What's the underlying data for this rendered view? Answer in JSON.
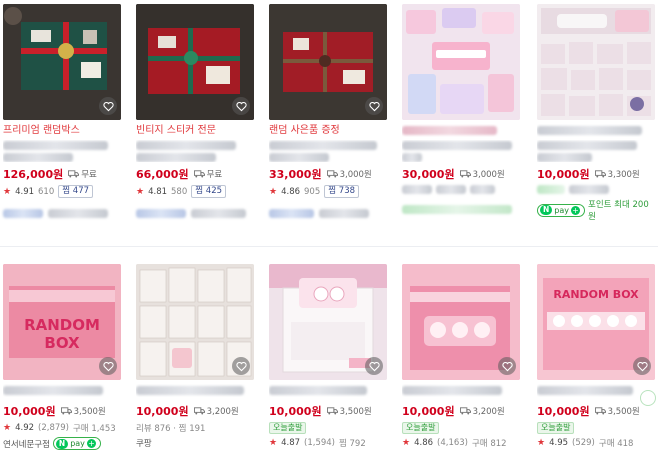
{
  "colors": {
    "price": "#d0001c",
    "title_red": "#e0373b",
    "npay": "#03c75a"
  },
  "row1": [
    {
      "title": "프리미엄 랜덤박스",
      "title_style": "red",
      "price": "126,000원",
      "ship": "무료",
      "rating": "4.91",
      "reviews": "610",
      "zzim_label": "찜",
      "zzim": "477",
      "extra": ""
    },
    {
      "title": "빈티지 스티커 전문",
      "title_style": "red",
      "price": "66,000원",
      "ship": "무료",
      "rating": "4.81",
      "reviews": "580",
      "zzim_label": "찜",
      "zzim": "425",
      "extra": ""
    },
    {
      "title": "랜덤 사은품 증정",
      "title_style": "red",
      "price": "33,000원",
      "ship": "3,000원",
      "rating": "4.86",
      "reviews": "905",
      "zzim_label": "찜",
      "zzim": "738",
      "extra": ""
    },
    {
      "title": "",
      "title_style": "red",
      "price": "30,000원",
      "ship": "3,000원",
      "rating": "",
      "reviews": "",
      "zzim_label": "",
      "zzim": "",
      "extra": "npay"
    },
    {
      "title": "",
      "title_style": "red",
      "price": "10,000원",
      "ship": "3,300원",
      "rating": "",
      "reviews": "",
      "zzim_label": "",
      "zzim": "",
      "extra": "npay_point",
      "point": "포인트 최대 200원"
    }
  ],
  "row2": [
    {
      "price": "10,000원",
      "ship": "3,500원",
      "rating": "4.92",
      "rating_count": "(2,879)",
      "meta": "구매 1,453",
      "seller": "연서네문구점",
      "tag": ""
    },
    {
      "price": "10,000원",
      "ship": "3,200원",
      "rating": "",
      "rating_count": "",
      "meta": "리뷰 876 · 찜 191",
      "seller": "쿠팡",
      "tag": ""
    },
    {
      "price": "10,000원",
      "ship": "3,500원",
      "rating": "4.87",
      "rating_count": "(1,594)",
      "meta": "찜 792",
      "seller": "",
      "tag": "오늘출발"
    },
    {
      "price": "10,000원",
      "ship": "3,200원",
      "rating": "4.86",
      "rating_count": "(4,163)",
      "meta": "구매 812",
      "seller": "",
      "tag": "오늘출발"
    },
    {
      "price": "10,000원",
      "ship": "3,500원",
      "rating": "4.95",
      "rating_count": "(529)",
      "meta": "구매 418",
      "seller": "",
      "tag": "오늘출발"
    }
  ],
  "labels": {
    "npay": "pay",
    "box_text_1": "RANDOM",
    "box_text_2": "BOX",
    "box_text_3": "RANDOM BOX"
  }
}
